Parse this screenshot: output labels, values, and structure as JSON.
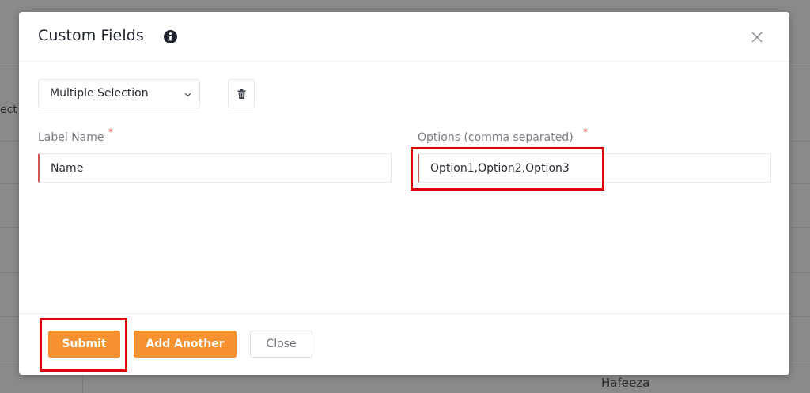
{
  "modal": {
    "title": "Custom Fields",
    "field_type": {
      "selected": "Multiple Selection"
    },
    "label_name": {
      "label": "Label Name",
      "required_mark": "*",
      "value": "Name"
    },
    "options": {
      "label": "Options (comma separated)",
      "required_mark": "*",
      "value": "Option1,Option2,Option3"
    },
    "footer": {
      "submit_label": "Submit",
      "add_another_label": "Add Another",
      "close_label": "Close"
    }
  },
  "background": {
    "cut_text_left": "ect",
    "name_bottom": "Hafeeza"
  },
  "colors": {
    "accent": "#f5922f",
    "required": "#e25555",
    "highlight": "#e0000b",
    "backdrop": "#8a8a8a"
  },
  "icons": {
    "title_info": "info-circle-icon",
    "close": "close-icon",
    "select_dropdown": "chevron-down-icon",
    "delete": "trash-icon"
  }
}
